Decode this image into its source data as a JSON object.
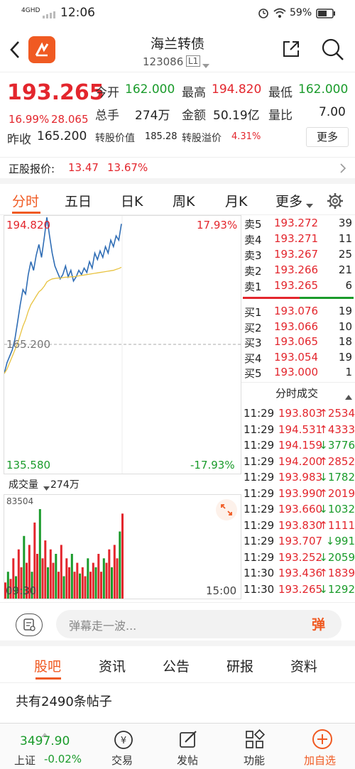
{
  "status_bar": {
    "network": "4GHD",
    "time": "12:06",
    "battery": "59%"
  },
  "header": {
    "title": "海兰转债",
    "code": "123086",
    "level": "L1"
  },
  "quote": {
    "price": "193.265",
    "change_pct": "16.99%",
    "change": "28.065",
    "open_label": "今开",
    "open": "162.000",
    "high_label": "最高",
    "high": "194.820",
    "low_label": "最低",
    "low": "162.000",
    "volume_label": "总手",
    "volume": "274万",
    "amount_label": "金额",
    "amount": "50.19亿",
    "ratio_label": "量比",
    "ratio": "7.00",
    "prev_close_label": "昨收",
    "prev_close": "165.200",
    "conv_value_label": "转股价值",
    "conv_value": "185.28",
    "premium_label": "转股溢价",
    "premium": "4.31%",
    "more": "更多"
  },
  "stock_line": {
    "label": "正股报价:",
    "price": "13.47",
    "pct": "13.67%"
  },
  "tabs": [
    "分时",
    "五日",
    "日K",
    "周K",
    "月K",
    "更多"
  ],
  "chart": {
    "high_label": "194.820",
    "high_pct": "17.93%",
    "mid_label": "165.200",
    "low_label": "135.580",
    "low_pct": "-17.93%",
    "volume_title": "成交量",
    "volume_value": "274万",
    "volume_max": "83504",
    "time_start": "09:30",
    "time_end": "15:00"
  },
  "chart_data": {
    "type": "line",
    "title": "",
    "x_range": [
      "09:30",
      "15:00"
    ],
    "ylim": [
      135.58,
      194.82
    ],
    "reference": 165.2,
    "series": [
      {
        "values": [
          158.5,
          161.0,
          162.5,
          164.0,
          166.5,
          170.5,
          174.5,
          178.0,
          177.0,
          181.5,
          184.5,
          182.5,
          186.0,
          188.5,
          185.5,
          190.0,
          194.8,
          190.5,
          186.5,
          183.5,
          182.0,
          180.5,
          181.5,
          183.5,
          181.0,
          182.5,
          180.0,
          181.0,
          182.5,
          181.5,
          183.0,
          182.0,
          184.5,
          183.0,
          186.5,
          185.0,
          187.0,
          185.5,
          188.0,
          186.5,
          189.5,
          188.0,
          190.5,
          189.5,
          193.3
        ]
      },
      {
        "values": [
          158.5,
          159.5,
          161.0,
          162.5,
          164.0,
          165.5,
          167.5,
          169.5,
          171.0,
          173.0,
          174.5,
          175.5,
          176.5,
          177.5,
          178.0,
          178.8,
          179.8,
          180.2,
          180.5,
          180.6,
          180.7,
          180.7,
          180.8,
          180.9,
          180.9,
          181.0,
          181.0,
          181.1,
          181.2,
          181.3,
          181.4,
          181.5,
          181.6,
          181.7,
          181.8,
          181.9,
          182.0,
          182.1,
          182.2,
          182.3,
          182.4,
          182.5,
          182.7,
          182.9,
          183.2
        ]
      }
    ],
    "volume": [
      18,
      30,
      22,
      45,
      25,
      55,
      35,
      70,
      40,
      60,
      30,
      85,
      50,
      100,
      45,
      65,
      35,
      55,
      40,
      50,
      30,
      60,
      25,
      45,
      35,
      50,
      30,
      40,
      28,
      35,
      25,
      45,
      30,
      40,
      35,
      50,
      30,
      45,
      40,
      55,
      35,
      60,
      45,
      75,
      95
    ],
    "volume_unit": "percent of max 83504"
  },
  "order_book": {
    "asks": [
      {
        "label": "卖5",
        "price": "193.272",
        "qty": "39"
      },
      {
        "label": "卖4",
        "price": "193.271",
        "qty": "11"
      },
      {
        "label": "卖3",
        "price": "193.267",
        "qty": "25"
      },
      {
        "label": "卖2",
        "price": "193.266",
        "qty": "21"
      },
      {
        "label": "卖1",
        "price": "193.265",
        "qty": "6"
      }
    ],
    "bids": [
      {
        "label": "买1",
        "price": "193.076",
        "qty": "19"
      },
      {
        "label": "买2",
        "price": "193.066",
        "qty": "10"
      },
      {
        "label": "买3",
        "price": "193.065",
        "qty": "18"
      },
      {
        "label": "买4",
        "price": "193.054",
        "qty": "19"
      },
      {
        "label": "买5",
        "price": "193.000",
        "qty": "1"
      }
    ]
  },
  "ticks": {
    "title": "分时成交",
    "rows": [
      {
        "time": "11:29",
        "price": "193.803",
        "dir": "↑",
        "qty": "2534"
      },
      {
        "time": "11:29",
        "price": "194.531",
        "dir": "↑",
        "qty": "4333"
      },
      {
        "time": "11:29",
        "price": "194.159",
        "dir": "↓",
        "qty": "3776"
      },
      {
        "time": "11:29",
        "price": "194.200",
        "dir": "↑",
        "qty": "2852"
      },
      {
        "time": "11:29",
        "price": "193.983",
        "dir": "↓",
        "qty": "1782"
      },
      {
        "time": "11:29",
        "price": "193.990",
        "dir": "↑",
        "qty": "2019"
      },
      {
        "time": "11:29",
        "price": "193.660",
        "dir": "↓",
        "qty": "1032"
      },
      {
        "time": "11:29",
        "price": "193.830",
        "dir": "↑",
        "qty": "1111"
      },
      {
        "time": "11:29",
        "price": "193.707",
        "dir": "↓",
        "qty": "991"
      },
      {
        "time": "11:29",
        "price": "193.252",
        "dir": "↓",
        "qty": "2059"
      },
      {
        "time": "11:30",
        "price": "193.436",
        "dir": "↑",
        "qty": "1839"
      },
      {
        "time": "11:30",
        "price": "193.265",
        "dir": "↓",
        "qty": "1292"
      }
    ]
  },
  "danmu": {
    "placeholder": "弹幕走一波...",
    "button": "弹"
  },
  "subtabs": [
    "股吧",
    "资讯",
    "公告",
    "研报",
    "资料"
  ],
  "posts": {
    "count_text": "共有2490条帖子"
  },
  "bottom_nav": {
    "index_value": "3497.90",
    "index_name": "上证",
    "index_pct": "-0.02%",
    "items": [
      "交易",
      "发帖",
      "功能",
      "加自选"
    ]
  },
  "colors": {
    "red": "#e3262d",
    "green": "#1a9b2b",
    "accent": "#f05a22",
    "line": "#2f6db5",
    "avg": "#e8c341"
  }
}
